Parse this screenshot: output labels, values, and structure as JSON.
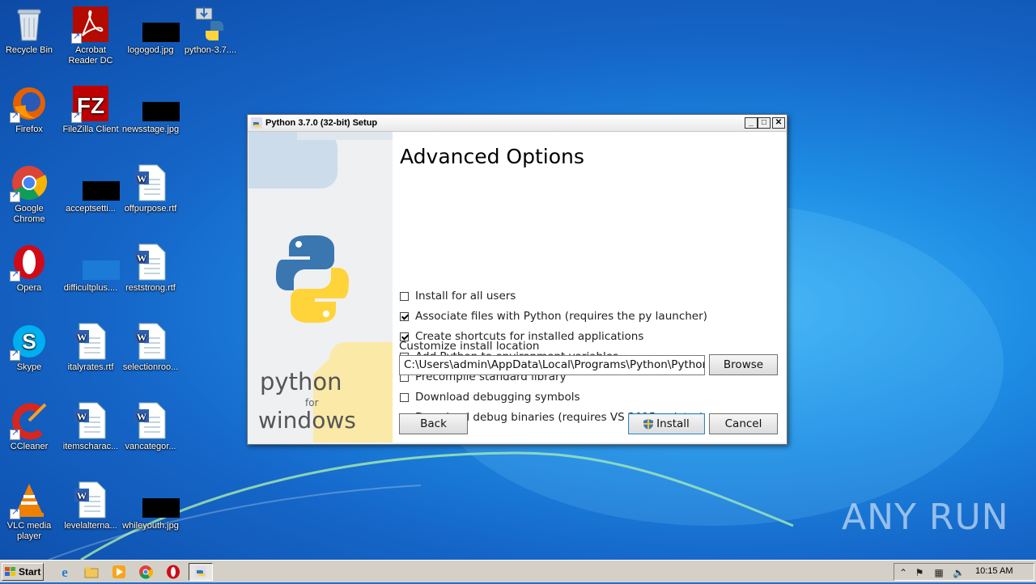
{
  "desktop": {
    "icons": [
      {
        "label": "Recycle Bin"
      },
      {
        "label": "Acrobat Reader DC"
      },
      {
        "label": "logogod.jpg"
      },
      {
        "label": "python-3.7...."
      },
      {
        "label": "Firefox"
      },
      {
        "label": "FileZilla Client"
      },
      {
        "label": "newsstage.jpg"
      },
      {
        "label": "Google Chrome"
      },
      {
        "label": "acceptsetti..."
      },
      {
        "label": "offpurpose.rtf"
      },
      {
        "label": "Opera"
      },
      {
        "label": "difficultplus...."
      },
      {
        "label": "reststrong.rtf"
      },
      {
        "label": "Skype"
      },
      {
        "label": "italyrates.rtf"
      },
      {
        "label": "selectionroo..."
      },
      {
        "label": "CCleaner"
      },
      {
        "label": "itemscharac..."
      },
      {
        "label": "vancategor..."
      },
      {
        "label": "VLC media player"
      },
      {
        "label": "levelalterna..."
      },
      {
        "label": "whileyouth.jpg"
      }
    ],
    "watermark": "ANY RUN"
  },
  "window": {
    "title": "Python 3.7.0 (32-bit) Setup",
    "minimize": "_",
    "maximize": "□",
    "close": "✕",
    "sidebar_text_top": "python",
    "sidebar_text_mid": "for",
    "sidebar_text_bottom": "windows",
    "heading": "Advanced Options",
    "options": [
      {
        "label": "Install for all users",
        "checked": false
      },
      {
        "label": "Associate files with Python (requires the py launcher)",
        "checked": true
      },
      {
        "label": "Create shortcuts for installed applications",
        "checked": true
      },
      {
        "label": "Add Python to environment variables",
        "checked": true
      },
      {
        "label": "Precompile standard library",
        "checked": false
      },
      {
        "label": "Download debugging symbols",
        "checked": false
      },
      {
        "label": "Download debug binaries (requires VS 2015 or later)",
        "checked": false
      }
    ],
    "location_label": "Customize install location",
    "location_value": "C:\\Users\\admin\\AppData\\Local\\Programs\\Python\\Python37-32",
    "browse": "Browse",
    "back": "Back",
    "install": "Install",
    "cancel": "Cancel"
  },
  "taskbar": {
    "start": "Start",
    "clock": "10:15 AM"
  },
  "colors": {
    "desktop_blue": "#1e8ee5",
    "python_blue": "#3a76b0",
    "python_yellow": "#ffd43b"
  }
}
